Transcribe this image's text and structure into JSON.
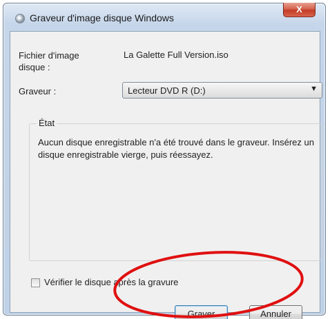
{
  "window": {
    "title": "Graveur d'image disque Windows",
    "close_label": "X",
    "accent_close_color": "#c33c26"
  },
  "form": {
    "image_label": "Fichier d'image disque :",
    "image_value": "La Galette Full Version.iso",
    "burner_label": "Graveur :",
    "burner_selected": "Lecteur DVD R (D:)"
  },
  "status": {
    "legend": "État",
    "message": "Aucun disque enregistrable n'a été trouvé dans le graveur. Insérez un disque enregistrable vierge, puis réessayez."
  },
  "verify": {
    "label": "Vérifier le disque après la gravure",
    "checked": false
  },
  "buttons": {
    "burn": "Graver",
    "cancel": "Annuler"
  },
  "annotation": {
    "shape": "ellipse",
    "color": "#e01010"
  }
}
